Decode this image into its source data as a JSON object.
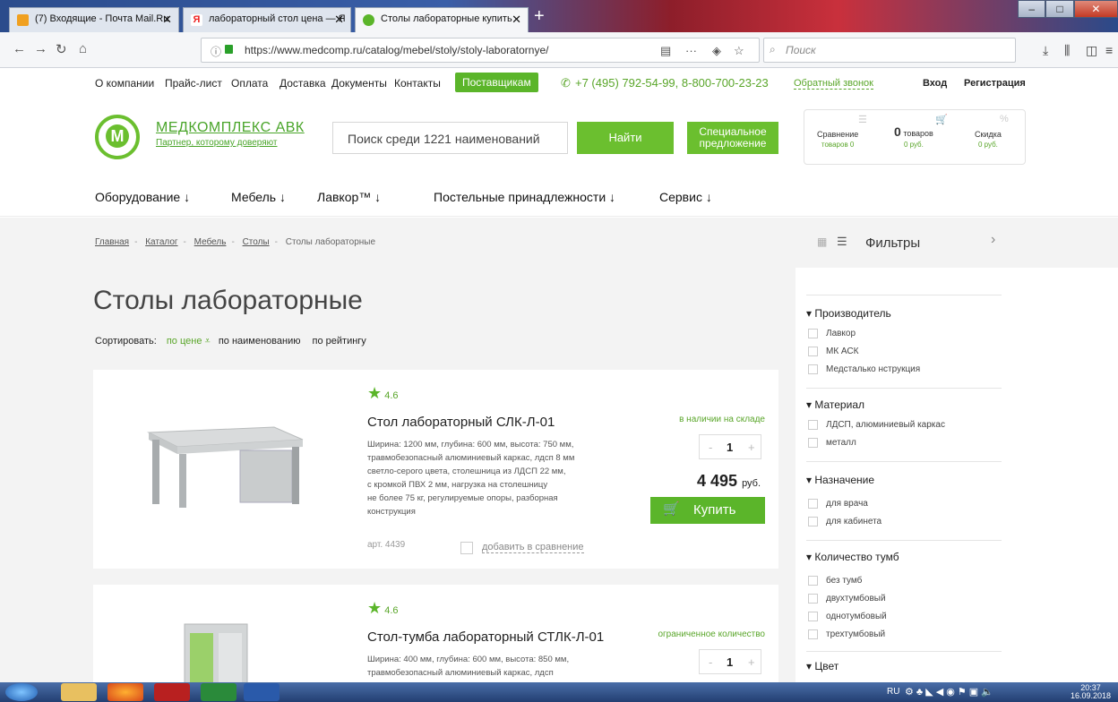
{
  "browser": {
    "tabs": [
      {
        "label": "(7) Входящие - Почта Mail.Ru",
        "close": "✕"
      },
      {
        "label": "лабораторный стол цена — Я",
        "close": "✕"
      },
      {
        "label": "Столы лабораторные купить",
        "close": "✕"
      }
    ],
    "new_tab": "+",
    "url": "https://www.medcomp.ru/catalog/mebel/stoly/stoly-laboratornye/",
    "search_placeholder": "Поиск",
    "window_controls": [
      "–",
      "□",
      "✕"
    ]
  },
  "topnav": {
    "links": [
      "О компании",
      "Прайс-лист",
      "Оплата",
      "Доставка",
      "Документы",
      "Контакты"
    ],
    "suppliers": "Поставщикам",
    "phones": "+7 (495) 792-54-99,  8-800-700-23-23",
    "callback": "Обратный звонок",
    "login": "Вход",
    "register": "Регистрация"
  },
  "header": {
    "logo_letter": "M",
    "brand": "МЕДКОМПЛЕКС АВК",
    "tagline": "Партнер, которому доверяют",
    "search_placeholder": "Поиск среди 1221 наименований",
    "find_button": "Найти",
    "special_offer": "Специальное предложение",
    "compare": {
      "label": "Сравнение",
      "value": "товаров 0"
    },
    "cart": {
      "count": "0",
      "unit": "товаров",
      "value": "0 руб."
    },
    "discount": {
      "label": "Скидка",
      "value": "0 руб."
    }
  },
  "mainnav": [
    "Оборудование ↓",
    "Мебель ↓",
    "Лавкор™ ↓",
    "Постельные принадлежности ↓",
    "Сервис ↓"
  ],
  "breadcrumbs": [
    "Главная",
    "Каталог",
    "Мебель",
    "Столы",
    "Столы лабораторные"
  ],
  "page_title": "Столы лабораторные",
  "sort": {
    "label": "Сортировать:",
    "by_price": "по цене",
    "by_name": "по наименованию",
    "by_rating": "по рейтингу"
  },
  "products": [
    {
      "rating": "4.6",
      "name": "Стол лабораторный СЛК-Л-01",
      "availability": "в наличии на складе",
      "qty": "1",
      "desc_lines": [
        "Ширина: 1200 мм, глубина: 600 мм, высота: 750 мм,",
        "травмобезопасный алюминиевый каркас, лдсп 8 мм",
        "светло-серого цвета, столешница из ЛДСП 22 мм,",
        "с кромкой ПВХ 2 мм, нагрузка на столешницу",
        "не более 75 кг, регулируемые опоры, разборная",
        "конструкция"
      ],
      "price": "4 495",
      "currency": "руб.",
      "buy": "Купить",
      "article": "арт. 4439",
      "compare": "добавить в сравнение"
    },
    {
      "rating": "4.6",
      "name": "Стол-тумба лабораторный СТЛК-Л-01",
      "availability": "ограниченное количество",
      "qty": "1",
      "desc_lines": [
        "Ширина: 400 мм, глубина: 600 мм, высота: 850 мм,",
        "травмобезопасный алюминиевый каркас, лдсп"
      ]
    }
  ],
  "filters": {
    "title": "Фильтры",
    "sections": [
      {
        "name": "Производитель",
        "items": [
          "Лавкор",
          "МК АСК",
          "Медсталько нструкция"
        ]
      },
      {
        "name": "Материал",
        "items": [
          "ЛДСП, алюминиевый каркас",
          "металл"
        ]
      },
      {
        "name": "Назначение",
        "items": [
          "для врача",
          "для кабинета"
        ]
      },
      {
        "name": "Количество тумб",
        "items": [
          "без тумб",
          "двухтумбовый",
          "однотумбовый",
          "трехтумбовый"
        ]
      },
      {
        "name": "Цвет",
        "items": []
      }
    ]
  },
  "taskbar": {
    "lang": "RU",
    "time": "20:37",
    "date": "16.09.2018"
  },
  "colors": {
    "accent": "#5bb52a",
    "link_green": "#5aa62a",
    "bg": "#f3f3f3"
  }
}
